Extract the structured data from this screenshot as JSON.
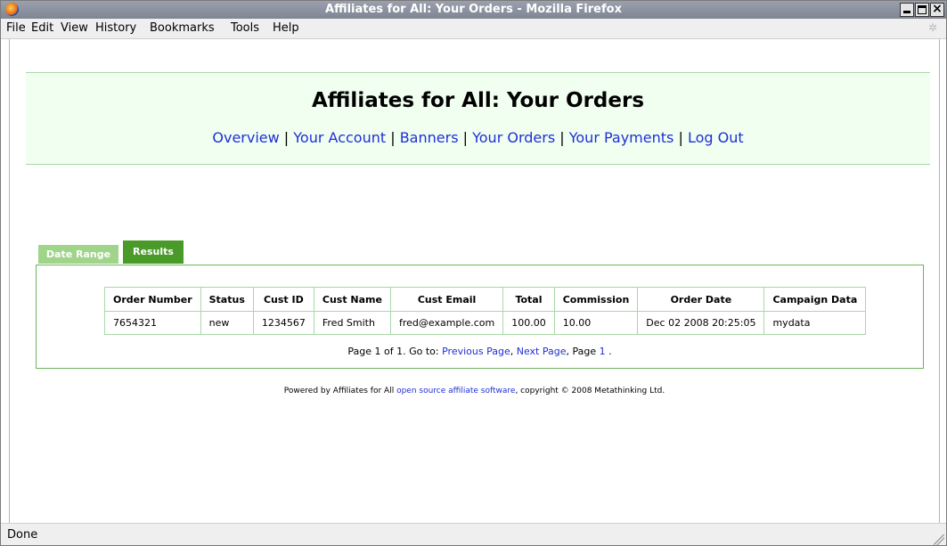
{
  "window": {
    "title": "Affiliates for All: Your Orders - Mozilla Firefox"
  },
  "menu": {
    "items": [
      "File",
      "Edit",
      "View",
      "History",
      "Bookmarks",
      "Tools",
      "Help"
    ]
  },
  "page": {
    "heading": "Affiliates for All: Your Orders",
    "nav": [
      "Overview",
      "Your Account",
      "Banners",
      "Your Orders",
      "Your Payments",
      "Log Out"
    ]
  },
  "tabs": {
    "date_range": "Date Range",
    "results": "Results"
  },
  "orders_table": {
    "columns": [
      "Order Number",
      "Status",
      "Cust ID",
      "Cust Name",
      "Cust Email",
      "Total",
      "Commission",
      "Order Date",
      "Campaign Data"
    ],
    "rows": [
      [
        "7654321",
        "new",
        "1234567",
        "Fred Smith",
        "fred@example.com",
        "100.00",
        "10.00",
        "Dec 02 2008 20:25:05",
        "mydata"
      ]
    ]
  },
  "pager": {
    "prefix": "Page 1 of 1. Go to: ",
    "prev": "Previous Page",
    "comma1": ", ",
    "next": "Next Page",
    "middle": ", Page ",
    "page1": "1",
    "suffix": " ."
  },
  "footer": {
    "prefix": "Powered by Affiliates for All ",
    "link": "open source affiliate software",
    "suffix": ", copyright © 2008 Metathinking Ltd."
  },
  "status": {
    "text": "Done"
  },
  "colors": {
    "link": "#1f2fd6",
    "header_bg": "#f0fff0",
    "tab_active": "#4a9a2a",
    "tab_inactive": "#9fd48a"
  }
}
